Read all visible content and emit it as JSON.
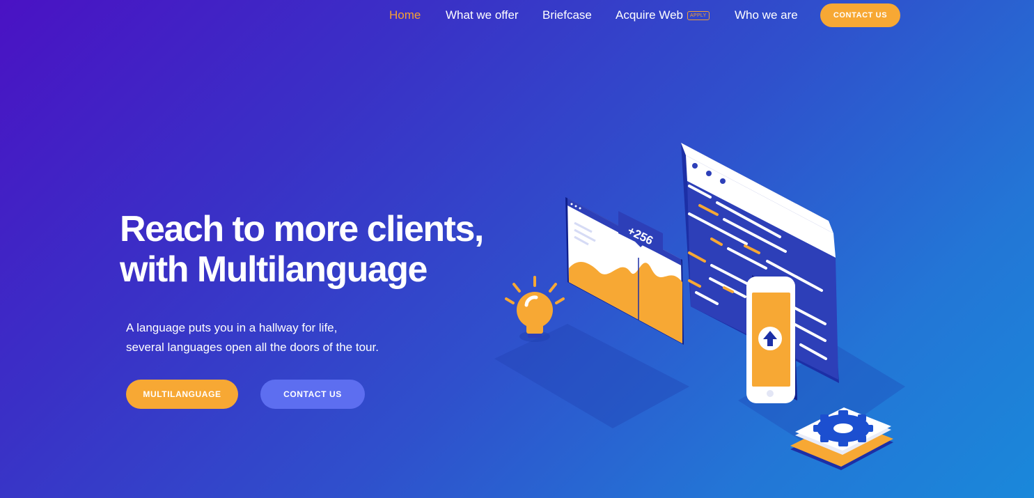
{
  "nav": {
    "items": [
      {
        "label": "Home",
        "active": true
      },
      {
        "label": "What we offer",
        "active": false
      },
      {
        "label": "Briefcase",
        "active": false
      },
      {
        "label": "Acquire Web",
        "active": false,
        "badge": "APPLY"
      },
      {
        "label": "Who we are",
        "active": false
      }
    ],
    "cta_label": "CONTACT US"
  },
  "hero": {
    "title_line1": "Reach to more clients,",
    "title_line2": "with Multilanguage",
    "subtitle_line1": "A language puts you in a hallway for life,",
    "subtitle_line2": "several languages open all the doors of the tour.",
    "primary_button": "MULTILANGUAGE",
    "secondary_button": "CONTACT US"
  },
  "illustration": {
    "chart_badge": "+256",
    "icons": [
      "lightbulb-icon",
      "browser-window-icon",
      "code-editor-icon",
      "smartphone-icon",
      "upload-arrow-icon",
      "gear-icon"
    ]
  },
  "colors": {
    "accent": "#f7a834",
    "secondary_button": "#5d6ef0",
    "gradient_start": "#4a12c4",
    "gradient_end": "#1a88da"
  }
}
